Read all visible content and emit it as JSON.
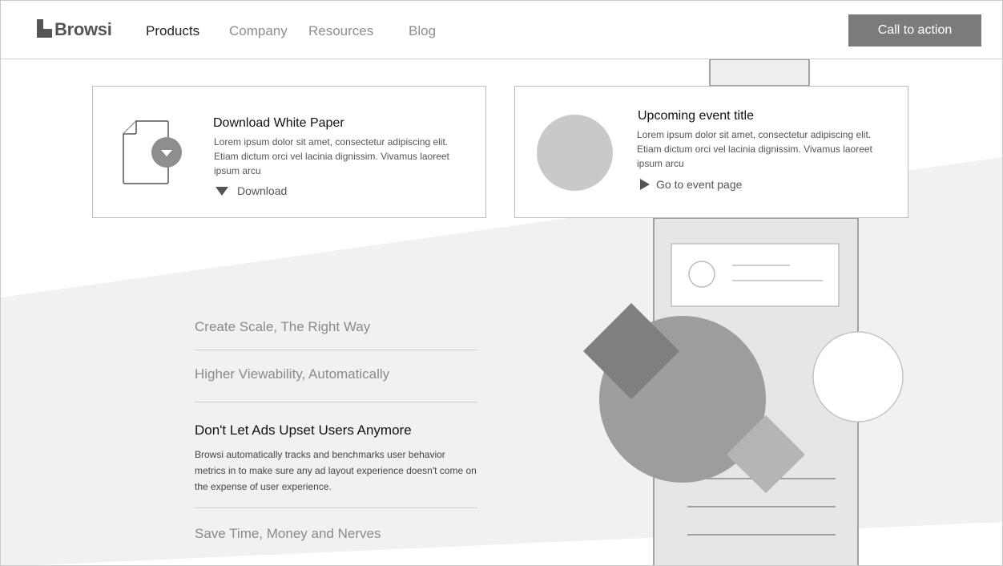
{
  "brand": {
    "name": "Browsi"
  },
  "nav": {
    "items": [
      {
        "label": "Products",
        "active": true
      },
      {
        "label": "Company",
        "active": false
      },
      {
        "label": "Resources",
        "active": false
      },
      {
        "label": "Blog",
        "active": false
      }
    ],
    "cta_label": "Call to action"
  },
  "cards": {
    "white_paper": {
      "title": "Download White Paper",
      "body": "Lorem ipsum dolor sit amet, consectetur adipiscing elit. Etiam dictum orci vel lacinia dignissim. Vivamus laoreet ipsum arcu",
      "link_label": "Download",
      "icon": "document-download-icon"
    },
    "event": {
      "title": "Upcoming event title",
      "body": "Lorem ipsum dolor sit amet, consectetur adipiscing elit. Etiam dictum orci vel lacinia dignissim. Vivamus laoreet ipsum arcu",
      "link_label": "Go to event page",
      "icon": "play-icon"
    }
  },
  "features": [
    {
      "title": "Create Scale, The Right Way",
      "active": false
    },
    {
      "title": "Higher Viewability, Automatically",
      "active": false
    },
    {
      "title": "Don't Let Ads Upset Users Anymore",
      "active": true,
      "description": "Browsi automatically tracks and benchmarks user behavior metrics in to make sure any ad layout experience doesn't come on the expense of user experience."
    },
    {
      "title": "Save Time, Money and Nerves",
      "active": false
    }
  ],
  "colors": {
    "cta_bg": "#7b7b7b",
    "band_bg": "#f1f1f1",
    "phone_bg": "#e6e6e6",
    "accent_gray": "#8e8e8e"
  }
}
